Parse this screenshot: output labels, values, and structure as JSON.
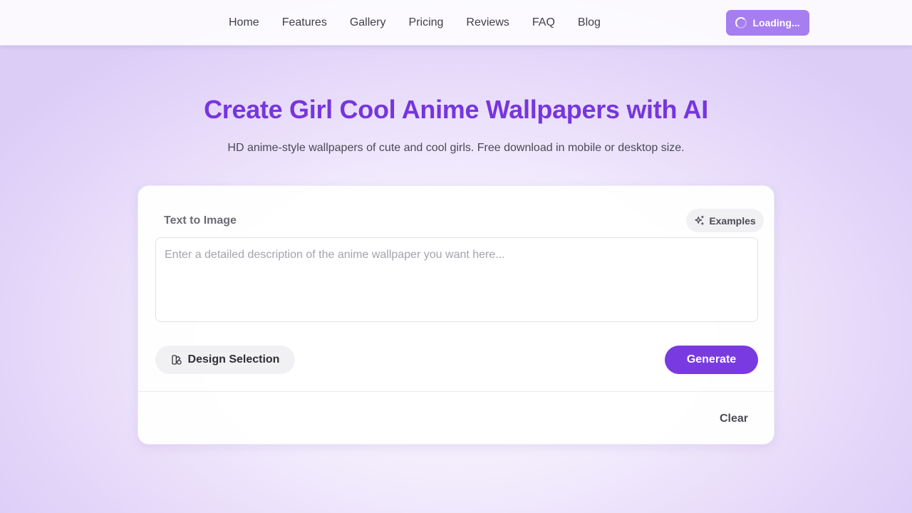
{
  "nav": {
    "links": [
      "Home",
      "Features",
      "Gallery",
      "Pricing",
      "Reviews",
      "FAQ",
      "Blog"
    ],
    "loading_label": "Loading..."
  },
  "hero": {
    "title": "Create Girl Cool Anime Wallpapers with AI",
    "subtitle": "HD anime-style wallpapers of cute and cool girls. Free download in mobile or desktop size."
  },
  "generator": {
    "mode_label": "Text to Image",
    "examples_label": "Examples",
    "prompt_value": "",
    "prompt_placeholder": "Enter a detailed description of the anime wallpaper you want here...",
    "design_selection_label": "Design Selection",
    "generate_label": "Generate",
    "clear_label": "Clear"
  },
  "icons": {
    "loading": "spinner-icon",
    "examples": "sparkles-icon",
    "design": "design-icon"
  },
  "colors": {
    "accent": "#7636dd",
    "generate_button": "#7a3ae2",
    "loading_button": "#a77ef0"
  }
}
